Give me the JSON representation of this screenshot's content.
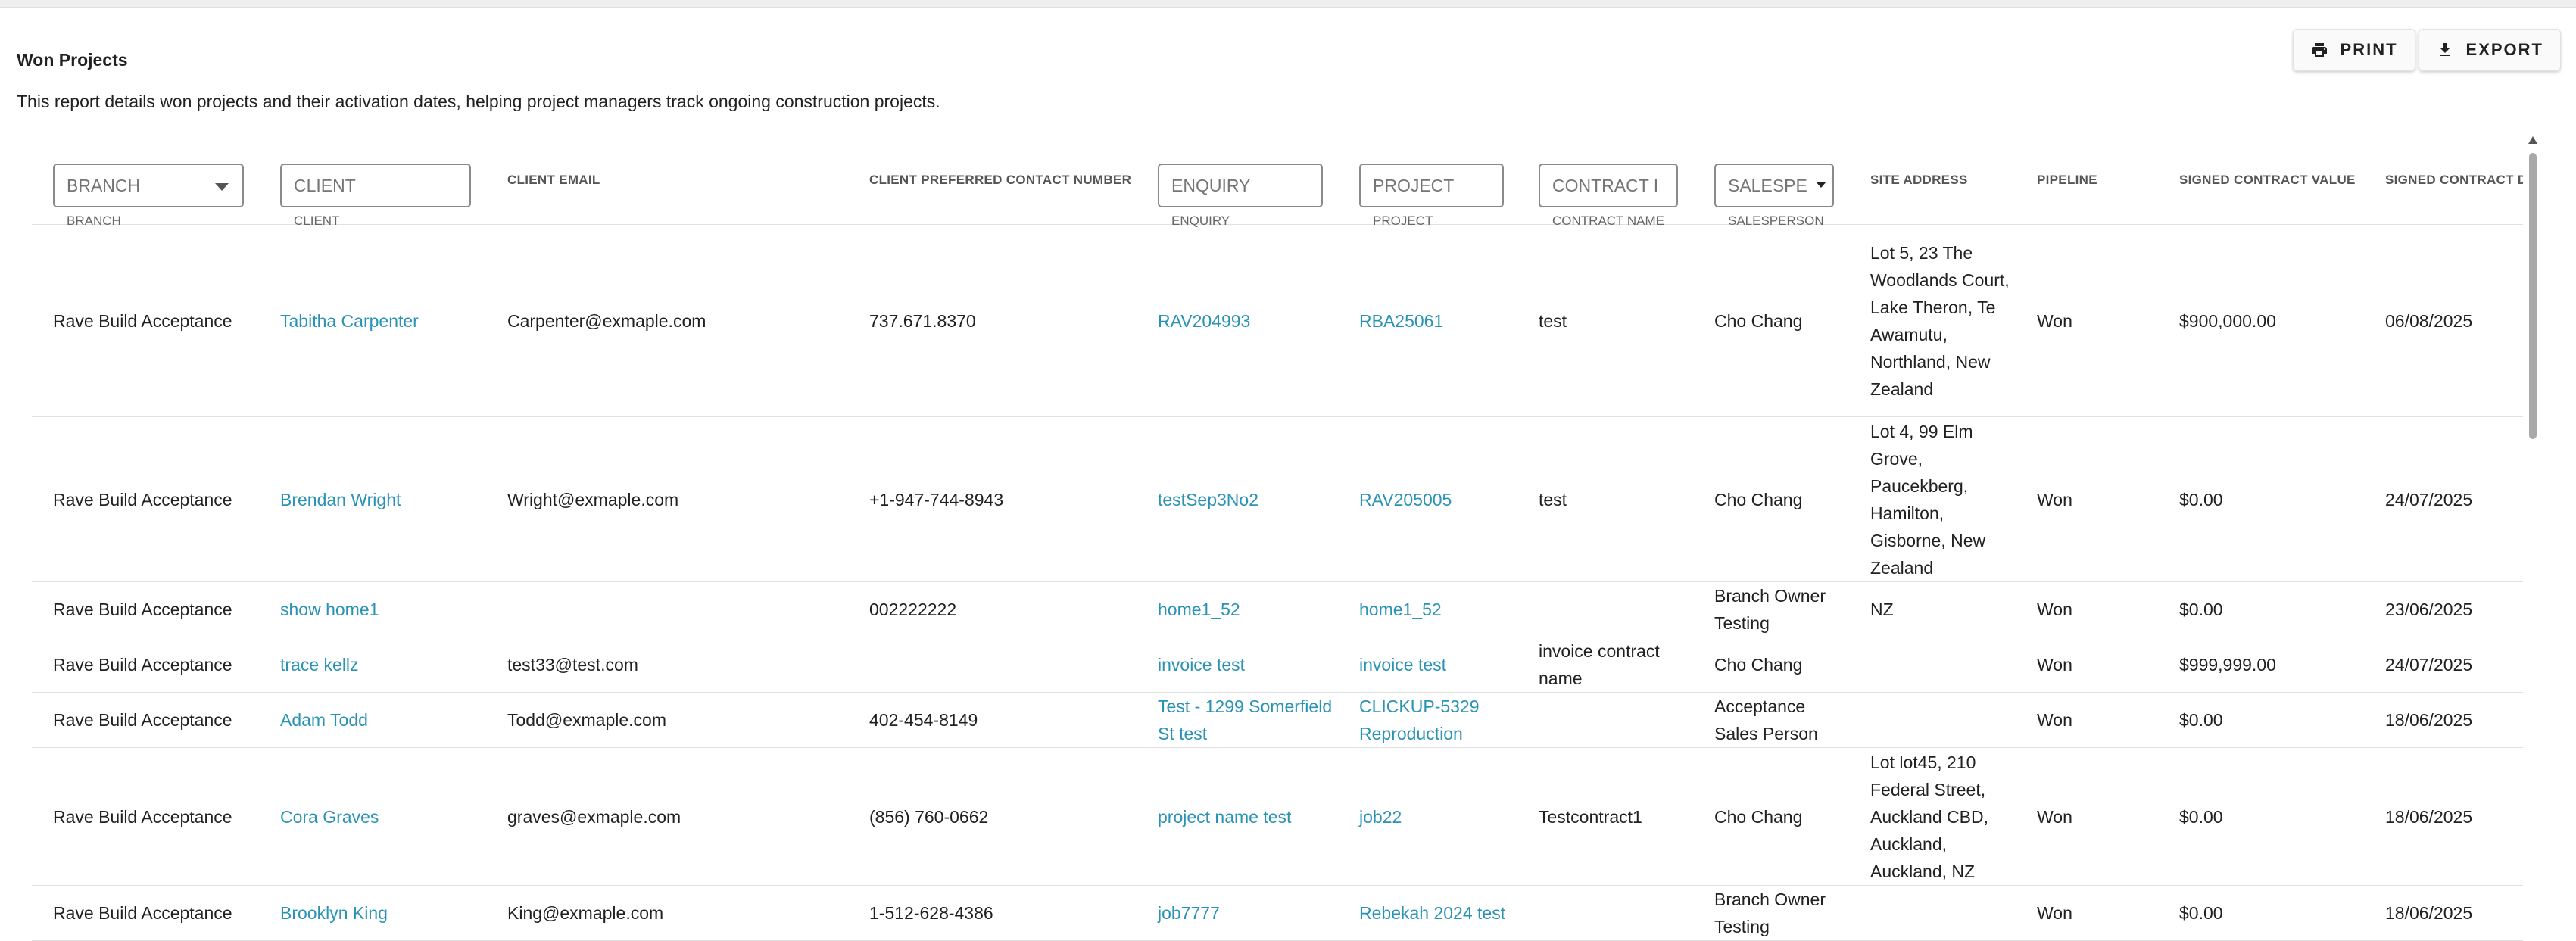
{
  "report": {
    "title": "Won Projects",
    "description": "This report details won projects and their activation dates, helping project managers track ongoing construction projects."
  },
  "toolbar": {
    "print_label": "PRINT",
    "export_label": "EXPORT"
  },
  "columns": {
    "branch": {
      "placeholder": "BRANCH",
      "caption": "BRANCH"
    },
    "client": {
      "placeholder": "CLIENT",
      "caption": "CLIENT"
    },
    "client_email": {
      "label": "CLIENT EMAIL"
    },
    "contact_number": {
      "label": "CLIENT PREFERRED CONTACT NUMBER"
    },
    "enquiry": {
      "placeholder": "ENQUIRY",
      "caption": "ENQUIRY"
    },
    "project": {
      "placeholder": "PROJECT",
      "caption": "PROJECT"
    },
    "contract_name": {
      "placeholder": "CONTRACT I",
      "caption": "CONTRACT NAME"
    },
    "salesperson": {
      "placeholder": "SALESPE",
      "caption": "SALESPERSON"
    },
    "site_address": {
      "label": "SITE ADDRESS"
    },
    "pipeline": {
      "label": "PIPELINE"
    },
    "signed_value": {
      "label": "SIGNED CONTRACT VALUE"
    },
    "signed_date": {
      "label": "SIGNED CONTRACT DA"
    }
  },
  "rows": [
    {
      "branch": "Rave Build Acceptance",
      "client": "Tabitha Carpenter",
      "email": "Carpenter@exmaple.com",
      "phone": "737.671.8370",
      "enquiry": "RAV204993",
      "project": "RBA25061",
      "contract": "test",
      "salesperson": "Cho Chang",
      "address": "Lot 5, 23 The Woodlands Court, Lake Theron, Te Awamutu, Northland, New Zealand",
      "pipeline": "Won",
      "value": "$900,000.00",
      "date": "06/08/2025"
    },
    {
      "branch": "Rave Build Acceptance",
      "client": "Brendan Wright",
      "email": "Wright@exmaple.com",
      "phone": "+1-947-744-8943",
      "enquiry": "testSep3No2",
      "project": "RAV205005",
      "contract": "test",
      "salesperson": "Cho Chang",
      "address": "Lot 4, 99 Elm Grove, Paucekberg, Hamilton, Gisborne, New Zealand",
      "pipeline": "Won",
      "value": "$0.00",
      "date": "24/07/2025"
    },
    {
      "branch": "Rave Build Acceptance",
      "client": "show home1",
      "email": "",
      "phone": "002222222",
      "enquiry": "home1_52",
      "project": "home1_52",
      "contract": "",
      "salesperson": "Branch Owner Testing",
      "address": "NZ",
      "pipeline": "Won",
      "value": "$0.00",
      "date": "23/06/2025"
    },
    {
      "branch": "Rave Build Acceptance",
      "client": "trace kellz",
      "email": "test33@test.com",
      "phone": "",
      "enquiry": "invoice test",
      "project": "invoice test",
      "contract": "invoice contract name",
      "salesperson": "Cho Chang",
      "address": "",
      "pipeline": "Won",
      "value": "$999,999.00",
      "date": "24/07/2025"
    },
    {
      "branch": "Rave Build Acceptance",
      "client": "Adam Todd",
      "email": "Todd@exmaple.com",
      "phone": "402-454-8149",
      "enquiry": "Test - 1299 Somerfield St test",
      "project": "CLICKUP-5329 Reproduction",
      "contract": "",
      "salesperson": "Acceptance Sales Person",
      "address": "",
      "pipeline": "Won",
      "value": "$0.00",
      "date": "18/06/2025"
    },
    {
      "branch": "Rave Build Acceptance",
      "client": "Cora Graves",
      "email": "graves@exmaple.com",
      "phone": "(856) 760-0662",
      "enquiry": "project name test",
      "project": "job22",
      "contract": "Testcontract1",
      "salesperson": "Cho Chang",
      "address": "Lot lot45, 210 Federal Street, Auckland CBD, Auckland, Auckland, NZ",
      "pipeline": "Won",
      "value": "$0.00",
      "date": "18/06/2025"
    },
    {
      "branch": "Rave Build Acceptance",
      "client": "Brooklyn King",
      "email": "King@exmaple.com",
      "phone": "1-512-628-4386",
      "enquiry": "job7777",
      "project": "Rebekah 2024 test",
      "contract": "",
      "salesperson": "Branch Owner Testing",
      "address": "",
      "pipeline": "Won",
      "value": "$0.00",
      "date": "18/06/2025"
    }
  ],
  "icons": {
    "print": "printer-icon",
    "export": "download-icon",
    "sort": "caret-down-icon"
  },
  "colors": {
    "link": "#2a93b5",
    "border": "#e0e0e0"
  }
}
